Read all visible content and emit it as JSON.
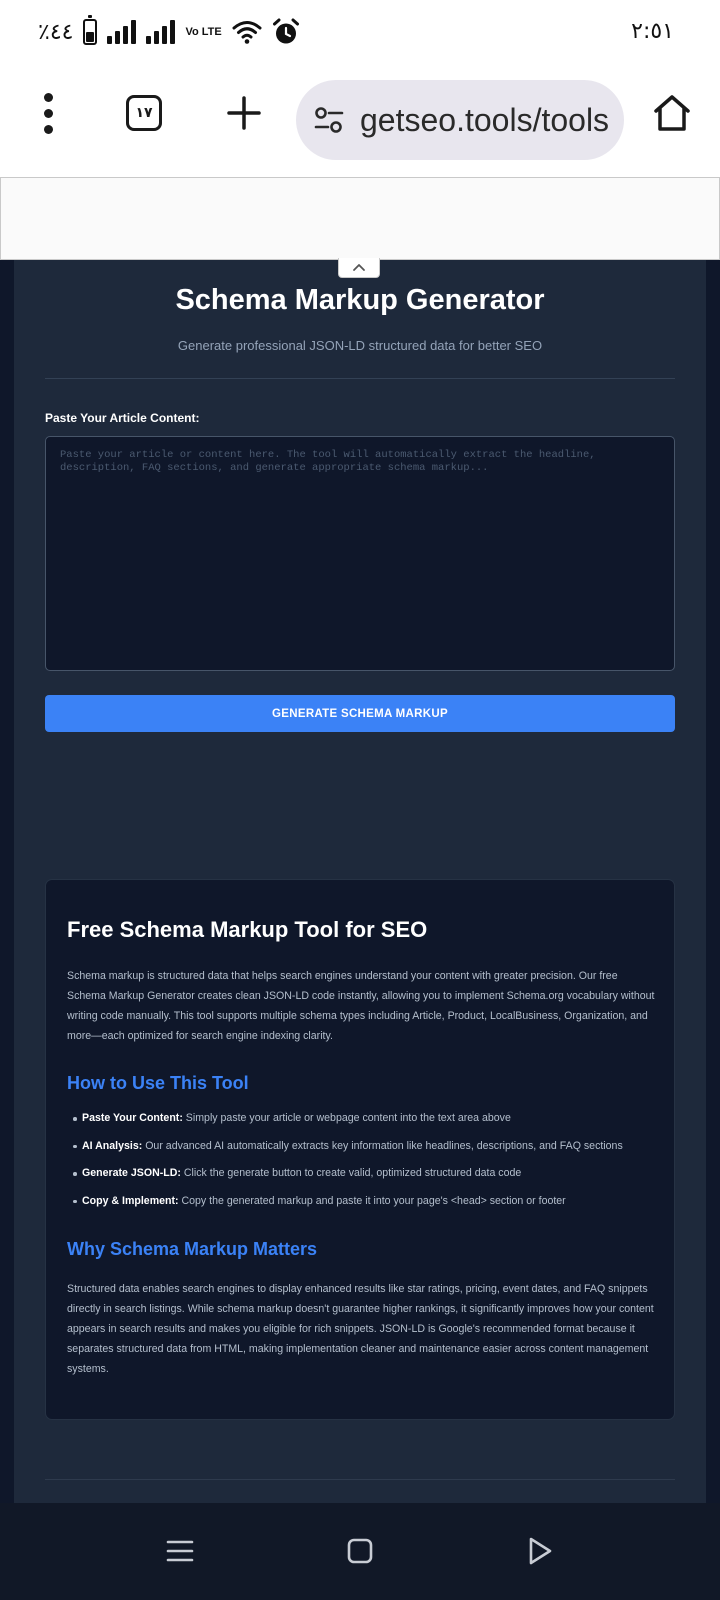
{
  "status_bar": {
    "battery_percent": "٪٤٤",
    "battery_level": 0.44,
    "volte_label": "Vo LTE",
    "time": "٢:٥١",
    "icons": [
      "battery-icon",
      "signal-icon",
      "signal-icon",
      "volte-icon",
      "wifi-icon",
      "alarm-icon"
    ]
  },
  "browser": {
    "menu_icon": "more-vertical-icon",
    "tab_count": "١٧",
    "new_tab_icon": "plus-icon",
    "site_settings_icon": "tune-icon",
    "url": "getseo.tools/tools",
    "home_icon": "home-icon"
  },
  "ad": {
    "collapse_icon": "chevron-up-icon"
  },
  "tool": {
    "title": "Schema Markup Generator",
    "subtitle": "Generate professional JSON-LD structured data for better SEO",
    "input_label": "Paste Your Article Content:",
    "input_value": "",
    "input_placeholder": "Paste your article or content here. The tool will automatically extract the headline, description, FAQ sections, and generate appropriate schema markup...",
    "generate_label": "GENERATE SCHEMA MARKUP"
  },
  "info": {
    "title": "Free Schema Markup Tool for SEO",
    "intro": "Schema markup is structured data that helps search engines understand your content with greater precision. Our free Schema Markup Generator creates clean JSON-LD code instantly, allowing you to implement Schema.org vocabulary without writing code manually. This tool supports multiple schema types including Article, Product, LocalBusiness, Organization, and more—each optimized for search engine indexing clarity.",
    "how_heading": "How to Use This Tool",
    "steps": [
      {
        "label": "Paste Your Content:",
        "text": " Simply paste your article or webpage content into the text area above"
      },
      {
        "label": "AI Analysis:",
        "text": " Our advanced AI automatically extracts key information like headlines, descriptions, and FAQ sections"
      },
      {
        "label": "Generate JSON-LD:",
        "text": " Click the generate button to create valid, optimized structured data code"
      },
      {
        "label": "Copy & Implement:",
        "text": " Copy the generated markup and paste it into your page's <head> section or footer"
      }
    ],
    "why_heading": "Why Schema Markup Matters",
    "why_text": "Structured data enables search engines to display enhanced results like star ratings, pricing, event dates, and FAQ snippets directly in search listings. While schema markup doesn't guarantee higher rankings, it significantly improves how your content appears in search results and makes you eligible for rich snippets. JSON-LD is Google's recommended format because it separates structured data from HTML, making implementation cleaner and maintenance easier across content management systems."
  },
  "nav": {
    "icons": [
      "recent-apps-icon",
      "home-square-icon",
      "back-icon"
    ]
  },
  "colors": {
    "accent": "#3b82f6",
    "card_bg": "#1e293b",
    "page_bg": "#0f172a",
    "muted_text": "#94a3b8"
  }
}
